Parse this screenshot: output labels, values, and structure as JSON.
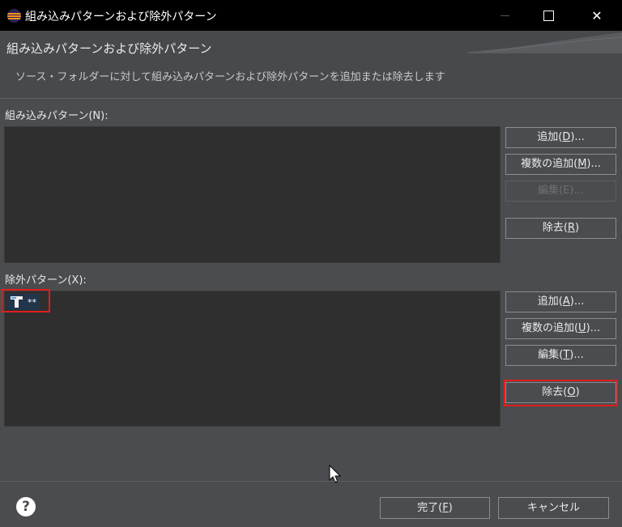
{
  "window": {
    "title": "組み込みパターンおよび除外パターン",
    "close_glyph": "✕"
  },
  "header": {
    "title": "組み込みパターンおよび除外パターン",
    "description": "ソース・フォルダーに対して組み込みパターンおよび除外パターンを追加または除去します"
  },
  "inclusion": {
    "label": "組み込みパターン(N):",
    "buttons": [
      {
        "text": "追加(",
        "mnemonic": "D",
        "suffix": ")...",
        "enabled": true
      },
      {
        "text": "複数の追加(",
        "mnemonic": "M",
        "suffix": ")...",
        "enabled": true
      },
      {
        "text": "編集(E)...",
        "mnemonic": "",
        "suffix": "",
        "enabled": false
      },
      {
        "text": "除去(",
        "mnemonic": "R",
        "suffix": ")",
        "enabled": true
      }
    ]
  },
  "exclusion": {
    "label": "除外パターン(X):",
    "items": [
      "**"
    ],
    "buttons": [
      {
        "text": "追加(",
        "mnemonic": "A",
        "suffix": ")...",
        "enabled": true
      },
      {
        "text": "複数の追加(",
        "mnemonic": "U",
        "suffix": ")...",
        "enabled": true
      },
      {
        "text": "編集(",
        "mnemonic": "T",
        "suffix": ")...",
        "enabled": true
      },
      {
        "text": "除去(",
        "mnemonic": "O",
        "suffix": ")",
        "enabled": true
      }
    ]
  },
  "footer": {
    "help_glyph": "?",
    "finish": {
      "text": "完了(",
      "mnemonic": "F",
      "suffix": ")"
    },
    "cancel": "キャンセル"
  },
  "colors": {
    "background": "#4a4c4f",
    "list_background": "#2f2f2f",
    "highlight": "#e01e1e",
    "selection": "#22354a"
  }
}
